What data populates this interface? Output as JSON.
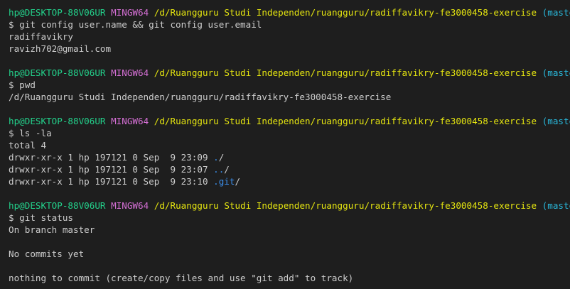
{
  "terminal": {
    "blocks": [
      {
        "prompt": {
          "user_host": "hp@DESKTOP-88V06UR",
          "system": "MINGW64",
          "path": "/d/Ruangguru Studi Independen/ruangguru/radiffavikry-fe3000458-exercise",
          "branch": "(master)"
        },
        "command": "$ git config user.name && git config user.email",
        "output": [
          "radiffavikry",
          "ravizh702@gmail.com"
        ]
      },
      {
        "prompt": {
          "user_host": "hp@DESKTOP-88V06UR",
          "system": "MINGW64",
          "path": "/d/Ruangguru Studi Independen/ruangguru/radiffavikry-fe3000458-exercise",
          "branch": "(master)"
        },
        "command": "$ pwd",
        "output": [
          "/d/Ruangguru Studi Independen/ruangguru/radiffavikry-fe3000458-exercise"
        ]
      },
      {
        "prompt": {
          "user_host": "hp@DESKTOP-88V06UR",
          "system": "MINGW64",
          "path": "/d/Ruangguru Studi Independen/ruangguru/radiffavikry-fe3000458-exercise",
          "branch": "(master)"
        },
        "command": "$ ls -la",
        "total": "total 4",
        "entries": [
          {
            "meta": "drwxr-xr-x 1 hp 197121 0 Sep  9 23:09 ",
            "name": ".",
            "suffix": "/"
          },
          {
            "meta": "drwxr-xr-x 1 hp 197121 0 Sep  9 23:07 ",
            "name": "..",
            "suffix": "/"
          },
          {
            "meta": "drwxr-xr-x 1 hp 197121 0 Sep  9 23:10 ",
            "name": ".git",
            "suffix": "/"
          }
        ]
      },
      {
        "prompt": {
          "user_host": "hp@DESKTOP-88V06UR",
          "system": "MINGW64",
          "path": "/d/Ruangguru Studi Independen/ruangguru/radiffavikry-fe3000458-exercise",
          "branch": "(master)"
        },
        "command": "$ git status",
        "output": [
          "On branch master",
          "",
          "No commits yet",
          "",
          "nothing to commit (create/copy files and use \"git add\" to track)"
        ]
      }
    ]
  },
  "colors": {
    "background": "#1e1e1e",
    "text": "#cccccc",
    "user_host": "#23d18b",
    "system": "#d670d6",
    "path": "#e5e510",
    "branch": "#29b8db",
    "directory": "#3b8eea"
  }
}
